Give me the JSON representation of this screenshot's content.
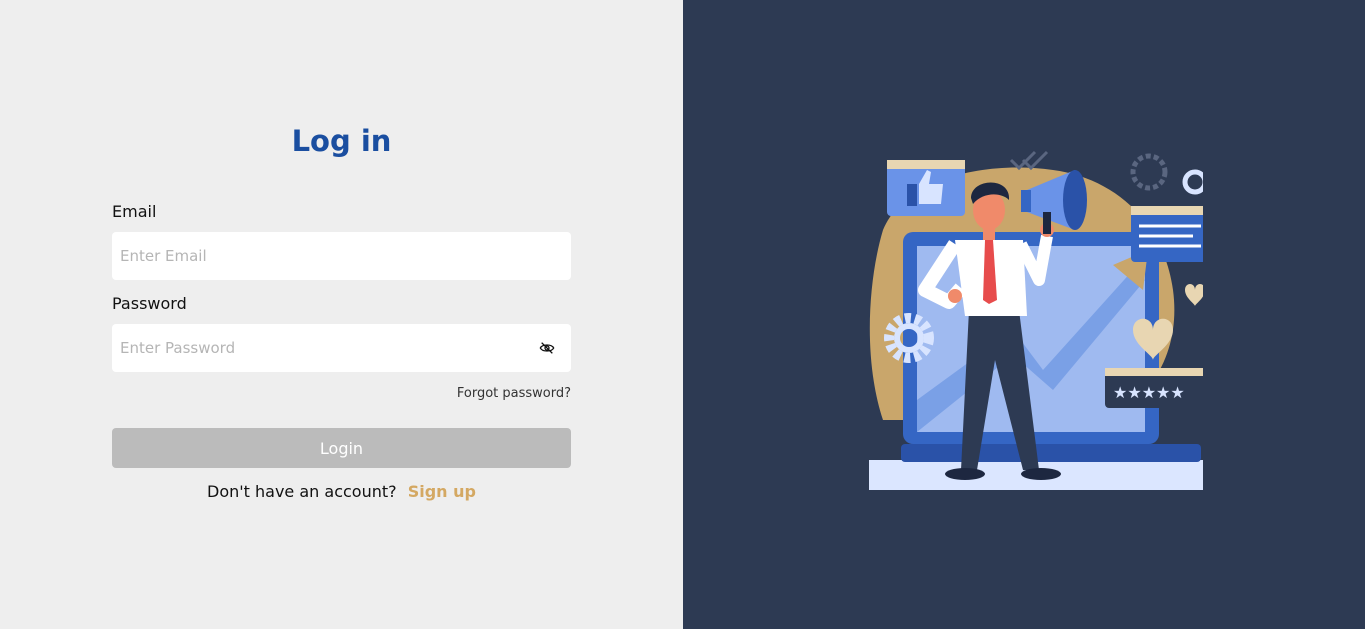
{
  "login": {
    "title": "Log in",
    "email_label": "Email",
    "email_placeholder": "Enter Email",
    "password_label": "Password",
    "password_placeholder": "Enter Password",
    "forgot_password": "Forgot password?",
    "login_button": "Login",
    "no_account_text": "Don't have an account?",
    "signup_link": "Sign up"
  },
  "icons": {
    "password_toggle": "eye-off-icon"
  },
  "colors": {
    "title": "#1a4ea0",
    "accent": "#d4a862",
    "button_disabled": "#bbbbbb",
    "panel_bg": "#2d3a53"
  }
}
